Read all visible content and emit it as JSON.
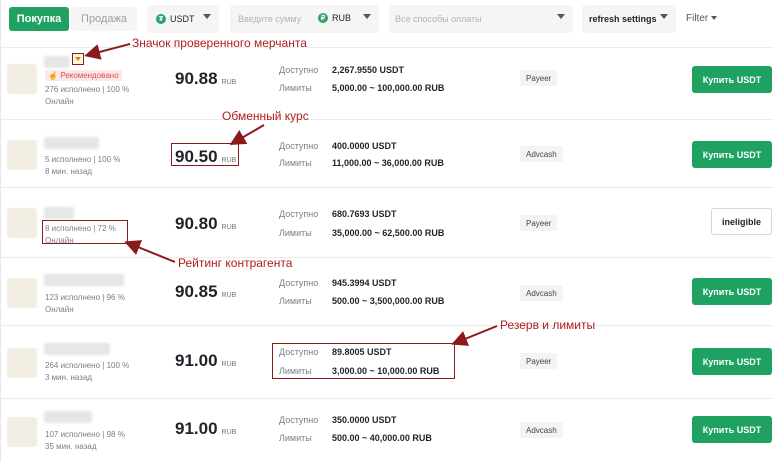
{
  "filters": {
    "tab_buy": "Покупка",
    "tab_sell": "Продажа",
    "coin": "USDT",
    "amount_placeholder": "Введите сумму",
    "fiat": "RUB",
    "payment_placeholder": "Все способы оплаты",
    "refresh": "refresh settings",
    "filter": "Filter"
  },
  "labels": {
    "available": "Доступно",
    "limits": "Лимиты",
    "currency": "RUB",
    "recommended": "Рекомендовано"
  },
  "rows": [
    {
      "stats": "276 исполнено  |  100 %",
      "status": "Онлайн",
      "price": "90.88",
      "available": "2,267.9550 USDT",
      "limits": "5,000.00 ~ 100,000.00 RUB",
      "payment": "Payeer",
      "action": "Купить USDT"
    },
    {
      "stats": "5 исполнено  |  100 %",
      "status": "8 мин. назад",
      "price": "90.50",
      "available": "400.0000 USDT",
      "limits": "11,000.00 ~ 36,000.00 RUB",
      "payment": "Advcash",
      "action": "Купить USDT"
    },
    {
      "stats": "8 исполнено  |  72 %",
      "status": "Онлайн",
      "price": "90.80",
      "available": "680.7693 USDT",
      "limits": "35,000.00 ~ 62,500.00 RUB",
      "payment": "Payeer",
      "action": "ineligible"
    },
    {
      "stats": "123 исполнено  |  96 %",
      "status": "Онлайн",
      "price": "90.85",
      "available": "945.3994 USDT",
      "limits": "500.00 ~ 3,500,000.00 RUB",
      "payment": "Advcash",
      "action": "Купить USDT"
    },
    {
      "stats": "264 исполнено  |  100 %",
      "status": "3 мин. назад",
      "price": "91.00",
      "available": "89.8005 USDT",
      "limits": "3,000.00 ~ 10,000.00 RUB",
      "payment": "Payeer",
      "action": "Купить USDT"
    },
    {
      "stats": "107 исполнено  |  98 %",
      "status": "35 мин. назад",
      "price": "91.00",
      "available": "350.0000 USDT",
      "limits": "500.00 ~ 40,000.00 RUB",
      "payment": "Advcash",
      "action": "Купить USDT"
    }
  ],
  "annotations": {
    "verified": "Значок проверенного мерчанта",
    "rate": "Обменный курс",
    "rating": "Рейтинг контрагента",
    "reserve": "Резерв и лимиты"
  },
  "colors": {
    "accent": "#1fa162",
    "annotation": "#b11b1b"
  }
}
